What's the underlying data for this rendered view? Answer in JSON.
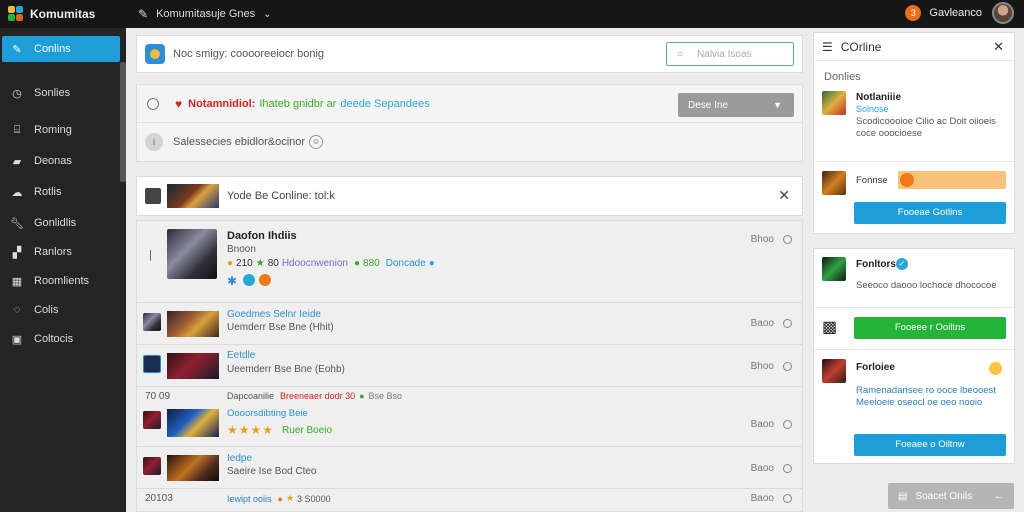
{
  "app": {
    "title": "Komumitas",
    "group_selector": "Komumitasuje Gnes",
    "username": "Gavleanco",
    "notif_count": "3"
  },
  "colors": {
    "accent": "#1e9ed8",
    "topbar": "#161616",
    "sidebar": "#242424",
    "danger": "#d42020",
    "success": "#25b43a",
    "warning": "#f8c27a"
  },
  "sidebar": {
    "items": [
      {
        "label": "Conlins",
        "icon": "pen-icon",
        "glyph": "✎",
        "active": true
      },
      {
        "label": "Sonlies",
        "icon": "clock-icon",
        "glyph": "◷"
      },
      {
        "label": "Roming",
        "icon": "chart-icon",
        "glyph": "⌸"
      },
      {
        "label": "Deonas",
        "icon": "folder-icon",
        "glyph": "▰"
      },
      {
        "label": "Rotlis",
        "icon": "cloud-icon",
        "glyph": "☁"
      },
      {
        "label": "Gonlidlis",
        "icon": "wrench-icon",
        "glyph": "🔧︎"
      },
      {
        "label": "Ranlors",
        "icon": "bag-icon",
        "glyph": "▞"
      },
      {
        "label": "Roomlients",
        "icon": "grid-icon",
        "glyph": "▦"
      },
      {
        "label": "Colis",
        "icon": "leaf-icon",
        "glyph": "◌"
      },
      {
        "label": "Coltocis",
        "icon": "box-icon",
        "glyph": "▣"
      }
    ]
  },
  "composer": {
    "prompt": "Noc smigy: cooooreeiocr bonig",
    "search_placeholder": "Nalvia Isoas"
  },
  "notice": {
    "part_a": "Notamnidiol:",
    "part_b": "Ihateb gnidbr ar",
    "part_c": "deede Sepandees",
    "filter_label": "Dese Ine",
    "subtext": "Salessecies ebidlor&ocinor"
  },
  "feed_head": {
    "title": "Yode Be Conline: tol:k"
  },
  "posts": [
    {
      "name": "Daofon Ihdiis",
      "sub": "Bnoon",
      "stats": "210",
      "stat_b": "80",
      "tags": "Hdoocnwenion",
      "count": "880",
      "link": "Doncade",
      "time": "Bhoo"
    },
    {
      "link": "Goedmes Selnr Ieide",
      "text": "Uemderr Bse Bne (Hhit)",
      "time": "Baoo"
    },
    {
      "link": "Eetdle",
      "text": "Ueemderr Bse Bne (Eohb)",
      "time": "Bhoo"
    },
    {
      "date": "70 09",
      "meta_a": "Dapcoanilie",
      "meta_b": "Breeneaer dodr 30",
      "meta_c": "Bse Bso",
      "link": "Oooorsdibting Beie",
      "text": "Ruer Boeio",
      "time": "Baoo"
    },
    {
      "link": "Iedpe",
      "text": "Saeire Ise Bod Cteo",
      "time": "Baoo"
    },
    {
      "date": "20103",
      "meta_a": "Iewipt ooiis",
      "meta_b": "3 S0000",
      "time": "Baoo"
    }
  ],
  "right": {
    "head_title": "COrline",
    "sub": "Donlies",
    "r1": {
      "name": "Notlaniiie",
      "small": "Solnose",
      "text": "Scodicoooioe Cilio ac Doit oiioeis coce ooocioese"
    },
    "r2": {
      "label": "Fonnse"
    },
    "btn1": "Fooeae Gotlins",
    "r3": {
      "name": "Fonltors",
      "text": "Seeoco daooo lochoce dhococoe"
    },
    "btn2": "Fooeee r Ooiltns",
    "r4": {
      "name": "Forloiee",
      "text": "Ramenadarisee ro ooce lbeooest Meeioeie oseocl oe oeo nooio"
    },
    "btn3": "Foeaee o Oiltnw"
  },
  "online_bar": {
    "label": "Soacet Onils"
  }
}
